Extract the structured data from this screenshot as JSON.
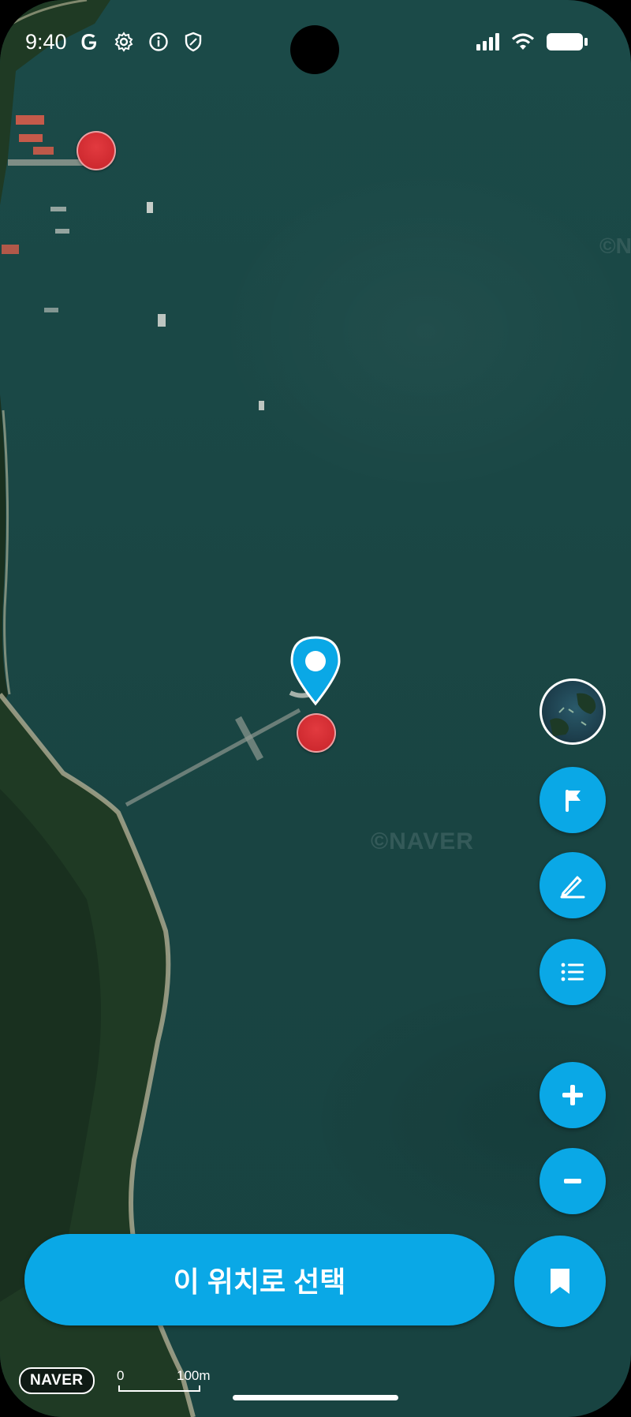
{
  "status_bar": {
    "time": "9:40",
    "left_icons": [
      "google-icon",
      "settings-icon",
      "info-icon",
      "shield-icon"
    ],
    "right_icons": [
      "signal-icon",
      "wifi-icon",
      "battery-icon"
    ]
  },
  "map": {
    "watermark": "©NAVER",
    "watermark_edge": "©N",
    "markers": [
      "red-dot-marker",
      "red-dot-marker",
      "location-pin-marker"
    ]
  },
  "controls": {
    "layer_button": "map-layer-thumbnail",
    "flag_button": "flag-icon",
    "edit_button": "pencil-icon",
    "list_button": "list-icon",
    "zoom_in_button": "plus-icon",
    "zoom_out_button": "minus-icon"
  },
  "bottom": {
    "select_label": "이 위치로 선택",
    "bookmark_button": "bookmark-icon"
  },
  "footer": {
    "logo": "NAVER",
    "scale_zero": "0",
    "scale_label": "100m"
  },
  "colors": {
    "accent": "#0aa8e6",
    "marker_red": "#d3303a",
    "water": "#1a4644"
  }
}
